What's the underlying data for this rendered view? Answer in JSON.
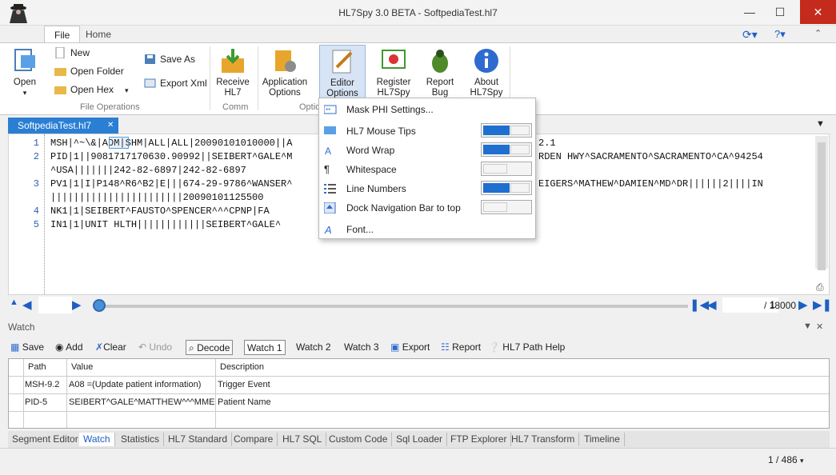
{
  "app": {
    "title": "HL7Spy 3.0 BETA - SoftpediaTest.hl7",
    "close": "✕"
  },
  "ribbon": {
    "tabs": [
      "File",
      "Home"
    ],
    "open": "Open",
    "new": "New",
    "open_folder": "Open Folder",
    "open_hex": "Open Hex",
    "save_as": "Save As",
    "export_xml": "Export Xml",
    "receive": "Receive HL7",
    "app_options": "Application Options",
    "editor_options": "Editor Options",
    "register": "Register HL7Spy",
    "report_bug": "Report Bug",
    "about": "About HL7Spy",
    "group_file_ops": "File Operations",
    "group_comm": "Comm",
    "group_options": "Optio"
  },
  "document": {
    "tab": "SoftpediaTest.hl7"
  },
  "editor": {
    "lines": [
      {
        "num": "1",
        "text": "MSH|^~\\&|ADM|SHM|ALL|ALL|20090101010000||A"
      },
      {
        "num": "2",
        "text": "PID|1||9081717170630.90992||SEIBERT^GALE^M"
      },
      {
        "num": "",
        "text": "^USA|||||||242-82-6897|242-82-6897"
      },
      {
        "num": "3",
        "text": "PV1|1|I|P148^R6^B2|E|||674-29-9786^WANSER^"
      },
      {
        "num": "",
        "text": "|||||||||||||||||||||||20090101125500"
      },
      {
        "num": "4",
        "text": "NK1|1|SEIBERT^FAUSTO^SPENCER^^^CPNP|FA"
      },
      {
        "num": "5",
        "text": "IN1|1|UNIT HLTH||||||||||||SEIBERT^GALE^"
      }
    ],
    "right_fragments": {
      "l1": "2.1",
      "l2": "RDEN HWY^SACRAMENTO^SACRAMENTO^CA^94254",
      "l3": "EIGERS^MATHEW^DAMIEN^MD^DR||||||2||||IN"
    }
  },
  "nav": {
    "current": "1",
    "total": "/ 18000"
  },
  "menu": {
    "items": [
      {
        "label": "Mask PHI Settings...",
        "toggle": null
      },
      {
        "label": "HL7 Mouse Tips",
        "toggle": true
      },
      {
        "label": "Word Wrap",
        "toggle": true
      },
      {
        "label": "Whitespace",
        "toggle": false
      },
      {
        "label": "Line Numbers",
        "toggle": true
      },
      {
        "label": "Dock Navigation Bar to top",
        "toggle": false
      },
      {
        "label": "Font...",
        "toggle": null
      }
    ]
  },
  "watch": {
    "title": "Watch",
    "toolbar": [
      "Save",
      "Add",
      "Clear",
      "Undo",
      "Decode",
      "Watch 1",
      "Watch 2",
      "Watch 3",
      "Export",
      "Report",
      "HL7 Path Help"
    ],
    "columns": [
      "Path",
      "Value",
      "Description"
    ],
    "rows": [
      [
        "MSH-9.2",
        "A08  =(Update patient information)",
        "Trigger Event"
      ],
      [
        "PID-5",
        "SEIBERT^GALE^MATTHEW^^^MME",
        "Patient Name"
      ]
    ]
  },
  "bottom_tabs": [
    "Segment Editor",
    "Watch",
    "Statistics",
    "HL7 Standard",
    "Compare",
    "HL7 SQL",
    "Custom Code",
    "Sql Loader",
    "FTP Explorer",
    "HL7 Transform",
    "Timeline"
  ],
  "status": {
    "count": "1 / 486"
  },
  "colors": {
    "accent": "#2a7fd4",
    "toggle_on": "#1f6fd0",
    "close": "#c42b1c"
  }
}
